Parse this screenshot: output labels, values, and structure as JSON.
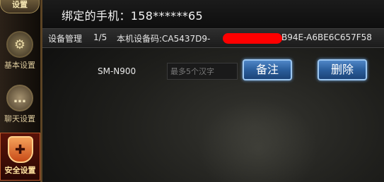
{
  "sidebar": {
    "top_tab": "设置",
    "items": [
      {
        "label": "基本设置",
        "icon": "gear-icon"
      },
      {
        "label": "聊天设置",
        "icon": "chat-bubble-icon"
      },
      {
        "label": "安全设置",
        "icon": "shield-plus-icon"
      }
    ]
  },
  "main": {
    "phone_line": "绑定的手机：158******65",
    "device_bar": {
      "manage_label": "设备管理",
      "count": "1/5",
      "code_label_prefix": "本机设备码:CA5437D9-",
      "code_tail": "B94E-A6BE6C657F58"
    },
    "device": {
      "name": "SM-N900",
      "remark_placeholder": "最多5个汉字",
      "remark_button": "备注",
      "delete_button": "删除"
    }
  },
  "colors": {
    "redaction": "#ff0000",
    "button_blue": "#2b5e9c",
    "active_tab": "#5a1208"
  }
}
